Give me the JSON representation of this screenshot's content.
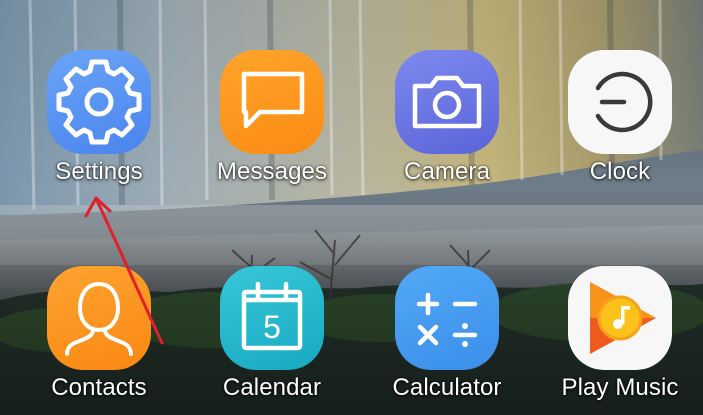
{
  "apps": [
    {
      "id": "settings",
      "label": "Settings",
      "icon": "gear-icon"
    },
    {
      "id": "messages",
      "label": "Messages",
      "icon": "chat-bubble-icon"
    },
    {
      "id": "camera",
      "label": "Camera",
      "icon": "camera-icon"
    },
    {
      "id": "clock",
      "label": "Clock",
      "icon": "clock-icon"
    },
    {
      "id": "contacts",
      "label": "Contacts",
      "icon": "person-icon"
    },
    {
      "id": "calendar",
      "label": "Calendar",
      "icon": "calendar-icon",
      "day": "5"
    },
    {
      "id": "calculator",
      "label": "Calculator",
      "icon": "calculator-icon"
    },
    {
      "id": "playmusic",
      "label": "Play Music",
      "icon": "play-music-icon"
    }
  ],
  "annotation": {
    "type": "red-arrow",
    "points_to": "settings",
    "color": "#e0202a"
  },
  "colors": {
    "settings": "#5b93f2",
    "messages": "#fb961f",
    "camera": "#6a74e2",
    "clock": "#f7f7f7",
    "contacts": "#fb961f",
    "calendar": "#26b7cd",
    "calculator": "#4a9bef",
    "playmusic": "#ffffff"
  }
}
